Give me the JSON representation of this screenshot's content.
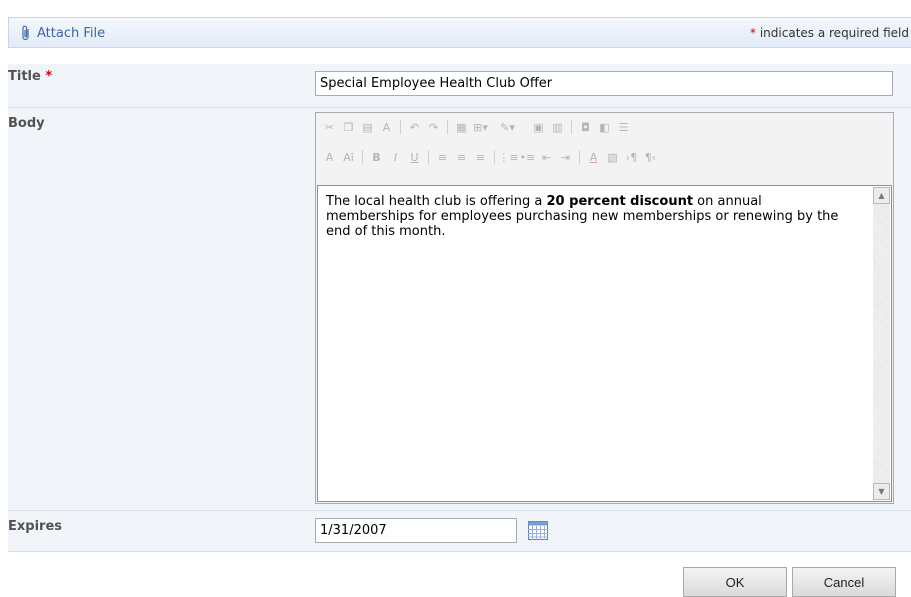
{
  "toolbar": {
    "attach_label": "Attach File",
    "required_star": "*",
    "required_text": " indicates a required field"
  },
  "fields": {
    "title": {
      "label": "Title",
      "required_star": " *",
      "value": "Special Employee Health Club Offer"
    },
    "body": {
      "label": "Body",
      "content": {
        "before": "The local health club is offering a ",
        "bold": "20 percent discount",
        "after": " on annual memberships for employees purchasing new memberships or renewing by the end of this month."
      },
      "toolbar_row1": [
        "cut-icon",
        "copy-icon",
        "paste-icon",
        "spellcheck-icon",
        "|",
        "undo-icon",
        "redo-icon",
        "|",
        "table-icon",
        "insert-table-icon",
        "|",
        "text-color-icon",
        "|",
        "image-icon",
        "link-icon",
        "|",
        "hyperlink-icon",
        "anchor-icon",
        "list-icon"
      ],
      "toolbar_row2": [
        "font-size-icon",
        "font-icon",
        "|",
        "bold-icon",
        "italic-icon",
        "underline-icon",
        "|",
        "align-left-icon",
        "align-center-icon",
        "align-right-icon",
        "|",
        "numbered-list-icon",
        "bullet-list-icon",
        "decrease-indent-icon",
        "increase-indent-icon",
        "|",
        "font-color-icon",
        "highlight-icon",
        "ltr-icon",
        "rtl-icon"
      ]
    },
    "expires": {
      "label": "Expires",
      "value": "1/31/2007"
    }
  },
  "buttons": {
    "ok": "OK",
    "cancel": "Cancel"
  },
  "colors": {
    "link": "#3d64a8",
    "required": "#d8000c",
    "label": "#525252"
  }
}
